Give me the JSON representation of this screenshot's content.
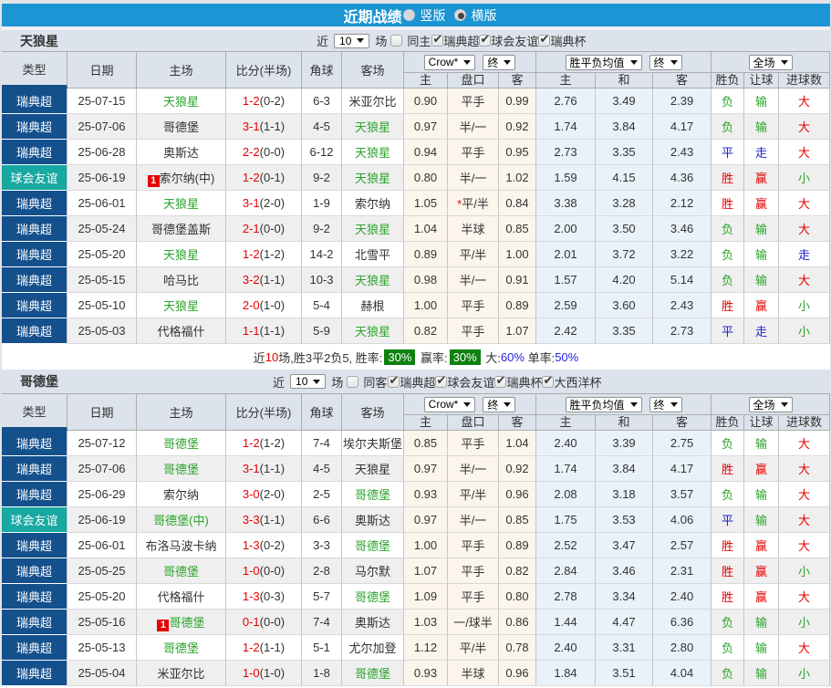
{
  "topbar": {
    "title": "近期战绩",
    "radios": [
      {
        "label": "竖版",
        "checked": false
      },
      {
        "label": "横版",
        "checked": true
      }
    ]
  },
  "colors": {
    "topbar_bg": "#1B95D3",
    "section_bar_bg": "#DCE3EC",
    "league_super_bg": "#14508C",
    "league_friendly_bg": "#16A8A1",
    "team_green": "#2CA42C",
    "result_red": "#E80000",
    "result_green": "#2CA42C",
    "result_blue": "#2020CC",
    "odds_bg": "#FCF5EC",
    "avg_bg": "#E9F2F9",
    "stripe_bg": "#EFEFEF",
    "badge_green": "#0E800E",
    "rate_blue": "#2222EE"
  },
  "table_header": {
    "left_cols": [
      "类型",
      "日期",
      "主场",
      "比分(半场)",
      "角球",
      "客场"
    ],
    "company_select": "Crow*",
    "company_final_select": "终",
    "odds_cols": [
      "主",
      "盘口",
      "客"
    ],
    "avg_select": "胜平负均值",
    "avg_final_select": "终",
    "avg_cols": [
      "主",
      "和",
      "客"
    ],
    "scope_select": "全场",
    "result_cols": [
      "胜负",
      "让球",
      "进球数"
    ]
  },
  "sections": [
    {
      "title": "天狼星",
      "filter": {
        "near_label": "近",
        "count": "10",
        "games_label": "场",
        "same": {
          "label": "同主",
          "checked": false
        },
        "leagues": [
          {
            "label": "瑞典超",
            "checked": true
          },
          {
            "label": "球会友谊",
            "checked": true
          },
          {
            "label": "瑞典杯",
            "checked": true
          }
        ]
      },
      "rows": [
        {
          "league": "瑞典超",
          "kind": "super",
          "date": "25-07-15",
          "home": {
            "name": "天狼星",
            "green": true,
            "card": false
          },
          "score": "1-2",
          "half": "(0-2)",
          "corner": "6-3",
          "away": {
            "name": "米亚尔比",
            "green": false
          },
          "odds": [
            "0.90",
            "平手",
            "0.99"
          ],
          "star": false,
          "avg": [
            "2.76",
            "3.49",
            "2.39"
          ],
          "results": [
            [
              "负",
              "g"
            ],
            [
              "输",
              "g"
            ],
            [
              "大",
              "r"
            ]
          ]
        },
        {
          "league": "瑞典超",
          "kind": "super",
          "date": "25-07-06",
          "home": {
            "name": "哥德堡",
            "green": false,
            "card": false
          },
          "score": "3-1",
          "half": "(1-1)",
          "corner": "4-5",
          "away": {
            "name": "天狼星",
            "green": true
          },
          "odds": [
            "0.97",
            "半/一",
            "0.92"
          ],
          "star": false,
          "avg": [
            "1.74",
            "3.84",
            "4.17"
          ],
          "results": [
            [
              "负",
              "g"
            ],
            [
              "输",
              "g"
            ],
            [
              "大",
              "r"
            ]
          ]
        },
        {
          "league": "瑞典超",
          "kind": "super",
          "date": "25-06-28",
          "home": {
            "name": "奥斯达",
            "green": false,
            "card": false
          },
          "score": "2-2",
          "half": "(0-0)",
          "corner": "6-12",
          "away": {
            "name": "天狼星",
            "green": true
          },
          "odds": [
            "0.94",
            "平手",
            "0.95"
          ],
          "star": false,
          "avg": [
            "2.73",
            "3.35",
            "2.43"
          ],
          "results": [
            [
              "平",
              "b"
            ],
            [
              "走",
              "b"
            ],
            [
              "大",
              "r"
            ]
          ]
        },
        {
          "league": "球会友谊",
          "kind": "friendly",
          "date": "25-06-19",
          "home": {
            "name": "索尔纳(中)",
            "green": false,
            "card": true
          },
          "score": "1-2",
          "half": "(0-1)",
          "corner": "9-2",
          "away": {
            "name": "天狼星",
            "green": true
          },
          "odds": [
            "0.80",
            "半/一",
            "1.02"
          ],
          "star": false,
          "avg": [
            "1.59",
            "4.15",
            "4.36"
          ],
          "results": [
            [
              "胜",
              "r"
            ],
            [
              "赢",
              "r"
            ],
            [
              "小",
              "g"
            ]
          ]
        },
        {
          "league": "瑞典超",
          "kind": "super",
          "date": "25-06-01",
          "home": {
            "name": "天狼星",
            "green": true,
            "card": false
          },
          "score": "3-1",
          "half": "(2-0)",
          "corner": "1-9",
          "away": {
            "name": "索尔纳",
            "green": false
          },
          "odds": [
            "1.05",
            "平/半",
            "0.84"
          ],
          "star": true,
          "avg": [
            "3.38",
            "3.28",
            "2.12"
          ],
          "results": [
            [
              "胜",
              "r"
            ],
            [
              "赢",
              "r"
            ],
            [
              "大",
              "r"
            ]
          ]
        },
        {
          "league": "瑞典超",
          "kind": "super",
          "date": "25-05-24",
          "home": {
            "name": "哥德堡盖斯",
            "green": false,
            "card": false
          },
          "score": "2-1",
          "half": "(0-0)",
          "corner": "9-2",
          "away": {
            "name": "天狼星",
            "green": true
          },
          "odds": [
            "1.04",
            "半球",
            "0.85"
          ],
          "star": false,
          "avg": [
            "2.00",
            "3.50",
            "3.46"
          ],
          "results": [
            [
              "负",
              "g"
            ],
            [
              "输",
              "g"
            ],
            [
              "大",
              "r"
            ]
          ]
        },
        {
          "league": "瑞典超",
          "kind": "super",
          "date": "25-05-20",
          "home": {
            "name": "天狼星",
            "green": true,
            "card": false
          },
          "score": "1-2",
          "half": "(1-2)",
          "corner": "14-2",
          "away": {
            "name": "北雪平",
            "green": false
          },
          "odds": [
            "0.89",
            "平/半",
            "1.00"
          ],
          "star": false,
          "avg": [
            "2.01",
            "3.72",
            "3.22"
          ],
          "results": [
            [
              "负",
              "g"
            ],
            [
              "输",
              "g"
            ],
            [
              "走",
              "b"
            ]
          ]
        },
        {
          "league": "瑞典超",
          "kind": "super",
          "date": "25-05-15",
          "home": {
            "name": "哈马比",
            "green": false,
            "card": false
          },
          "score": "3-2",
          "half": "(1-1)",
          "corner": "10-3",
          "away": {
            "name": "天狼星",
            "green": true
          },
          "odds": [
            "0.98",
            "半/一",
            "0.91"
          ],
          "star": false,
          "avg": [
            "1.57",
            "4.20",
            "5.14"
          ],
          "results": [
            [
              "负",
              "g"
            ],
            [
              "输",
              "g"
            ],
            [
              "大",
              "r"
            ]
          ]
        },
        {
          "league": "瑞典超",
          "kind": "super",
          "date": "25-05-10",
          "home": {
            "name": "天狼星",
            "green": true,
            "card": false
          },
          "score": "2-0",
          "half": "(1-0)",
          "corner": "5-4",
          "away": {
            "name": "赫根",
            "green": false
          },
          "odds": [
            "1.00",
            "平手",
            "0.89"
          ],
          "star": false,
          "avg": [
            "2.59",
            "3.60",
            "2.43"
          ],
          "results": [
            [
              "胜",
              "r"
            ],
            [
              "赢",
              "r"
            ],
            [
              "小",
              "g"
            ]
          ]
        },
        {
          "league": "瑞典超",
          "kind": "super",
          "date": "25-05-03",
          "home": {
            "name": "代格福什",
            "green": false,
            "card": false
          },
          "score": "1-1",
          "half": "(1-1)",
          "corner": "5-9",
          "away": {
            "name": "天狼星",
            "green": true
          },
          "odds": [
            "0.82",
            "平手",
            "1.07"
          ],
          "star": false,
          "avg": [
            "2.42",
            "3.35",
            "2.73"
          ],
          "results": [
            [
              "平",
              "b"
            ],
            [
              "走",
              "b"
            ],
            [
              "小",
              "g"
            ]
          ]
        }
      ],
      "summary": [
        {
          "t": "近",
          "c": "k"
        },
        {
          "t": "10",
          "c": "red"
        },
        {
          "t": "场,胜3平2负5, 胜率:",
          "c": "k"
        },
        {
          "t": "30%",
          "c": "badge"
        },
        {
          "t": " 赢率:",
          "c": "k"
        },
        {
          "t": "30%",
          "c": "badge"
        },
        {
          "t": " 大:",
          "c": "k"
        },
        {
          "t": "60%",
          "c": "blue"
        },
        {
          "t": " 单率:",
          "c": "k"
        },
        {
          "t": "50%",
          "c": "blue"
        }
      ]
    },
    {
      "title": "哥德堡",
      "filter": {
        "near_label": "近",
        "count": "10",
        "games_label": "场",
        "same": {
          "label": "同客",
          "checked": false
        },
        "leagues": [
          {
            "label": "瑞典超",
            "checked": true
          },
          {
            "label": "球会友谊",
            "checked": true
          },
          {
            "label": "瑞典杯",
            "checked": true
          },
          {
            "label": "大西洋杯",
            "checked": true
          }
        ]
      },
      "rows": [
        {
          "league": "瑞典超",
          "kind": "super",
          "date": "25-07-12",
          "home": {
            "name": "哥德堡",
            "green": true,
            "card": false
          },
          "score": "1-2",
          "half": "(1-2)",
          "corner": "7-4",
          "away": {
            "name": "埃尔夫斯堡",
            "green": false
          },
          "odds": [
            "0.85",
            "平手",
            "1.04"
          ],
          "star": false,
          "avg": [
            "2.40",
            "3.39",
            "2.75"
          ],
          "results": [
            [
              "负",
              "g"
            ],
            [
              "输",
              "g"
            ],
            [
              "大",
              "r"
            ]
          ]
        },
        {
          "league": "瑞典超",
          "kind": "super",
          "date": "25-07-06",
          "home": {
            "name": "哥德堡",
            "green": true,
            "card": false
          },
          "score": "3-1",
          "half": "(1-1)",
          "corner": "4-5",
          "away": {
            "name": "天狼星",
            "green": false
          },
          "odds": [
            "0.97",
            "半/一",
            "0.92"
          ],
          "star": false,
          "avg": [
            "1.74",
            "3.84",
            "4.17"
          ],
          "results": [
            [
              "胜",
              "r"
            ],
            [
              "赢",
              "r"
            ],
            [
              "大",
              "r"
            ]
          ]
        },
        {
          "league": "瑞典超",
          "kind": "super",
          "date": "25-06-29",
          "home": {
            "name": "索尔纳",
            "green": false,
            "card": false
          },
          "score": "3-0",
          "half": "(2-0)",
          "corner": "2-5",
          "away": {
            "name": "哥德堡",
            "green": true
          },
          "odds": [
            "0.93",
            "平/半",
            "0.96"
          ],
          "star": false,
          "avg": [
            "2.08",
            "3.18",
            "3.57"
          ],
          "results": [
            [
              "负",
              "g"
            ],
            [
              "输",
              "g"
            ],
            [
              "大",
              "r"
            ]
          ]
        },
        {
          "league": "球会友谊",
          "kind": "friendly",
          "date": "25-06-19",
          "home": {
            "name": "哥德堡(中)",
            "green": true,
            "card": false
          },
          "score": "3-3",
          "half": "(1-1)",
          "corner": "6-6",
          "away": {
            "name": "奥斯达",
            "green": false
          },
          "odds": [
            "0.97",
            "半/一",
            "0.85"
          ],
          "star": false,
          "avg": [
            "1.75",
            "3.53",
            "4.06"
          ],
          "results": [
            [
              "平",
              "b"
            ],
            [
              "输",
              "g"
            ],
            [
              "大",
              "r"
            ]
          ]
        },
        {
          "league": "瑞典超",
          "kind": "super",
          "date": "25-06-01",
          "home": {
            "name": "布洛马波卡纳",
            "green": false,
            "card": false
          },
          "score": "1-3",
          "half": "(0-2)",
          "corner": "3-3",
          "away": {
            "name": "哥德堡",
            "green": true
          },
          "odds": [
            "1.00",
            "平手",
            "0.89"
          ],
          "star": false,
          "avg": [
            "2.52",
            "3.47",
            "2.57"
          ],
          "results": [
            [
              "胜",
              "r"
            ],
            [
              "赢",
              "r"
            ],
            [
              "大",
              "r"
            ]
          ]
        },
        {
          "league": "瑞典超",
          "kind": "super",
          "date": "25-05-25",
          "home": {
            "name": "哥德堡",
            "green": true,
            "card": false
          },
          "score": "1-0",
          "half": "(0-0)",
          "corner": "2-8",
          "away": {
            "name": "马尔默",
            "green": false
          },
          "odds": [
            "1.07",
            "平手",
            "0.82"
          ],
          "star": false,
          "avg": [
            "2.84",
            "3.46",
            "2.31"
          ],
          "results": [
            [
              "胜",
              "r"
            ],
            [
              "赢",
              "r"
            ],
            [
              "小",
              "g"
            ]
          ]
        },
        {
          "league": "瑞典超",
          "kind": "super",
          "date": "25-05-20",
          "home": {
            "name": "代格福什",
            "green": false,
            "card": false
          },
          "score": "1-3",
          "half": "(0-3)",
          "corner": "5-7",
          "away": {
            "name": "哥德堡",
            "green": true
          },
          "odds": [
            "1.09",
            "平手",
            "0.80"
          ],
          "star": false,
          "avg": [
            "2.78",
            "3.34",
            "2.40"
          ],
          "results": [
            [
              "胜",
              "r"
            ],
            [
              "赢",
              "r"
            ],
            [
              "大",
              "r"
            ]
          ]
        },
        {
          "league": "瑞典超",
          "kind": "super",
          "date": "25-05-16",
          "home": {
            "name": "哥德堡",
            "green": true,
            "card": true
          },
          "score": "0-1",
          "half": "(0-0)",
          "corner": "7-4",
          "away": {
            "name": "奥斯达",
            "green": false
          },
          "odds": [
            "1.03",
            "一/球半",
            "0.86"
          ],
          "star": false,
          "avg": [
            "1.44",
            "4.47",
            "6.36"
          ],
          "results": [
            [
              "负",
              "g"
            ],
            [
              "输",
              "g"
            ],
            [
              "小",
              "g"
            ]
          ]
        },
        {
          "league": "瑞典超",
          "kind": "super",
          "date": "25-05-13",
          "home": {
            "name": "哥德堡",
            "green": true,
            "card": false
          },
          "score": "1-2",
          "half": "(1-1)",
          "corner": "5-1",
          "away": {
            "name": "尤尔加登",
            "green": false
          },
          "odds": [
            "1.12",
            "平/半",
            "0.78"
          ],
          "star": false,
          "avg": [
            "2.40",
            "3.31",
            "2.80"
          ],
          "results": [
            [
              "负",
              "g"
            ],
            [
              "输",
              "g"
            ],
            [
              "大",
              "r"
            ]
          ]
        },
        {
          "league": "瑞典超",
          "kind": "super",
          "date": "25-05-04",
          "home": {
            "name": "米亚尔比",
            "green": false,
            "card": false
          },
          "score": "1-0",
          "half": "(1-0)",
          "corner": "1-8",
          "away": {
            "name": "哥德堡",
            "green": true
          },
          "odds": [
            "0.93",
            "半球",
            "0.96"
          ],
          "star": false,
          "avg": [
            "1.84",
            "3.51",
            "4.04"
          ],
          "results": [
            [
              "负",
              "g"
            ],
            [
              "输",
              "g"
            ],
            [
              "小",
              "g"
            ]
          ]
        }
      ],
      "summary": null
    }
  ]
}
